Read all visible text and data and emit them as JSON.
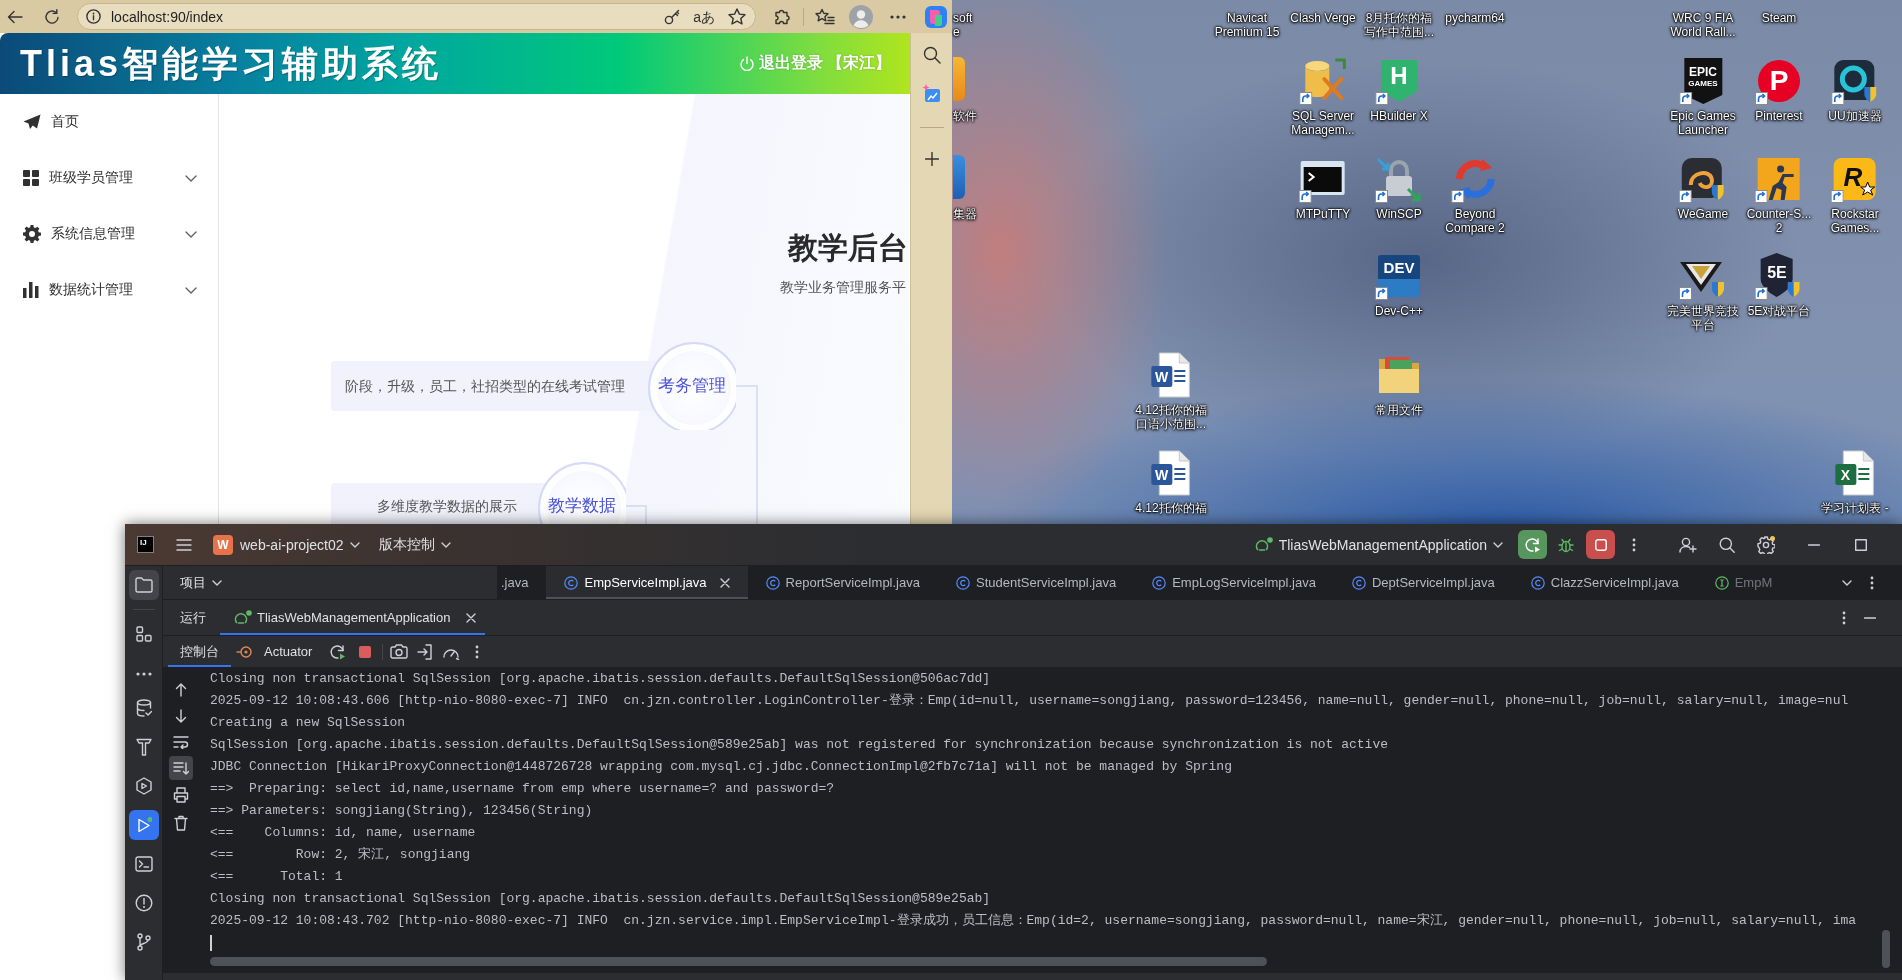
{
  "browser": {
    "address": "localhost:90/index",
    "read_aloud_glyph": "aあ",
    "app": {
      "title": "Tlias智能学习辅助系统",
      "logout": "退出登录 【宋江】",
      "menu": [
        {
          "label": "首页",
          "expandable": false
        },
        {
          "label": "班级学员管理",
          "expandable": true
        },
        {
          "label": "系统信息管理",
          "expandable": true
        },
        {
          "label": "数据统计管理",
          "expandable": true
        }
      ],
      "hero": {
        "title": "教学后台",
        "subtitle": "教学业务管理服务平"
      },
      "features": [
        {
          "description": "阶段，升级，员工，社招类型的在线考试管理",
          "topic": "考务管理"
        },
        {
          "description": "多维度教学数据的展示",
          "topic": "教学数据"
        }
      ]
    }
  },
  "desktop_icons": [
    {
      "kind": "clipped",
      "label": [
        "soft",
        "e"
      ]
    },
    {
      "kind": "label_only",
      "label": [
        "Navicat",
        "Premium 15"
      ]
    },
    {
      "kind": "label_only",
      "label": [
        "Clash Verge"
      ]
    },
    {
      "kind": "label_only",
      "label": [
        "8月托你的福",
        "写作中范围..."
      ]
    },
    {
      "kind": "label_only",
      "label": [
        "pycharm64"
      ]
    },
    {
      "kind": "label_only",
      "label": [
        "WRC 9 FIA",
        "World Rall..."
      ]
    },
    {
      "kind": "label_only",
      "label": [
        "Steam"
      ]
    },
    {
      "kind": "clipped",
      "label": [
        "软件"
      ]
    },
    {
      "kind": "app",
      "label": [
        "SQL Server",
        "Managem..."
      ],
      "shortcut": true
    },
    {
      "kind": "app",
      "label": [
        "HBuilder X"
      ],
      "shortcut": true,
      "glyph": [
        "H"
      ]
    },
    {
      "kind": "app",
      "label": [
        "Epic Games",
        "Launcher"
      ],
      "shortcut": true,
      "glyph": [
        "EPIC",
        "GAMES"
      ]
    },
    {
      "kind": "app",
      "label": [
        "Pinterest"
      ],
      "shortcut": true,
      "glyph": [
        "P"
      ]
    },
    {
      "kind": "app",
      "label": [
        "UU加速器"
      ],
      "shortcut": true
    },
    {
      "kind": "clipped",
      "label": [
        "集器"
      ]
    },
    {
      "kind": "app",
      "label": [
        "MTPuTTY"
      ],
      "shortcut": true
    },
    {
      "kind": "app",
      "label": [
        "WinSCP"
      ],
      "shortcut": true
    },
    {
      "kind": "app",
      "label": [
        "Beyond",
        "Compare 2"
      ],
      "shortcut": true
    },
    {
      "kind": "app",
      "label": [
        "WeGame"
      ],
      "shortcut": true
    },
    {
      "kind": "app",
      "label": [
        "Counter-S...",
        "2"
      ],
      "shortcut": true
    },
    {
      "kind": "app",
      "label": [
        "Rockstar",
        "Games..."
      ],
      "shortcut": true,
      "glyph": [
        "R"
      ]
    },
    {
      "kind": "app",
      "label": [
        "Dev-C++"
      ],
      "shortcut": true,
      "glyph": [
        "DEV"
      ]
    },
    {
      "kind": "app",
      "label": [
        "完美世界竞技",
        "平台"
      ],
      "shortcut": true
    },
    {
      "kind": "app",
      "label": [
        "5E对战平台"
      ],
      "shortcut": true,
      "glyph": [
        "5E"
      ]
    },
    {
      "kind": "app",
      "label": [
        "4.12托你的福",
        "口语小范围..."
      ],
      "shortcut": false,
      "glyph": [
        "W"
      ]
    },
    {
      "kind": "app",
      "label": [
        "常用文件"
      ],
      "shortcut": false
    },
    {
      "kind": "app",
      "label": [
        "4.12托你的福"
      ],
      "shortcut": false,
      "glyph": [
        "W"
      ]
    },
    {
      "kind": "app",
      "label": [
        "学习计划表 -"
      ],
      "shortcut": false,
      "glyph": [
        "X"
      ]
    }
  ],
  "ide": {
    "logo": "IJ",
    "project": {
      "badge": "W",
      "name": "web-ai-project02"
    },
    "vcs": "版本控制",
    "run_config": "TliasWebManagementApplication",
    "app_running": true,
    "settings_badge": true,
    "tool_windows": [
      {
        "selected": true
      },
      {
        "selected": false
      },
      {
        "selected": false
      },
      {
        "selected": false
      },
      {
        "selected": false
      },
      {
        "selected": false
      },
      {
        "selected": true
      },
      {
        "selected": false
      },
      {
        "selected": false
      },
      {
        "selected": false
      }
    ],
    "project_panel": "项目",
    "editor_tabs": [
      {
        "label": ".java",
        "kind": "plain",
        "selected": false
      },
      {
        "label": "EmpServiceImpl.java",
        "kind": "class",
        "selected": true
      },
      {
        "label": "ReportServiceImpl.java",
        "kind": "class",
        "selected": false
      },
      {
        "label": "StudentServiceImpl.java",
        "kind": "class",
        "selected": false
      },
      {
        "label": "EmpLogServiceImpl.java",
        "kind": "class",
        "selected": false
      },
      {
        "label": "DeptServiceImpl.java",
        "kind": "class",
        "selected": false
      },
      {
        "label": "ClazzServiceImpl.java",
        "kind": "class",
        "selected": false
      },
      {
        "label": "EmpM",
        "kind": "interface",
        "selected": false
      }
    ],
    "run_panel": {
      "title": "运行",
      "tabs": [
        {
          "label": "TliasWebManagementApplication",
          "selected": true
        }
      ]
    },
    "console_tabs": [
      {
        "label": "控制台",
        "selected": true
      },
      {
        "label": "Actuator",
        "selected": false
      }
    ],
    "console_toggles": {
      "soft_wrap": false,
      "scroll_to_end": true
    },
    "console_lines": [
      "Closing non transactional SqlSession [org.apache.ibatis.session.defaults.DefaultSqlSession@506ac7dd]",
      "2025-09-12 10:08:43.606 [http-nio-8080-exec-7] INFO  cn.jzn.controller.LoginController-登录：Emp(id=null, username=songjiang, password=123456, name=null, gender=null, phone=null, job=null, salary=null, image=nul",
      "Creating a new SqlSession",
      "SqlSession [org.apache.ibatis.session.defaults.DefaultSqlSession@589e25ab] was not registered for synchronization because synchronization is not active",
      "JDBC Connection [HikariProxyConnection@1448726728 wrapping com.mysql.cj.jdbc.ConnectionImpl@2fb7c71a] will not be managed by Spring",
      "==>  Preparing: select id,name,username from emp where username=? and password=?",
      "==> Parameters: songjiang(String), 123456(String)",
      "<==    Columns: id, name, username",
      "<==        Row: 2, 宋江, songjiang",
      "<==      Total: 1",
      "Closing non transactional SqlSession [org.apache.ibatis.session.defaults.DefaultSqlSession@589e25ab]",
      "2025-09-12 10:08:43.702 [http-nio-8080-exec-7] INFO  cn.jzn.service.impl.EmpServiceImpl-登录成功，员工信息：Emp(id=2, username=songjiang, password=null, name=宋江, gender=null, phone=null, job=null, salary=null, ima"
    ]
  }
}
